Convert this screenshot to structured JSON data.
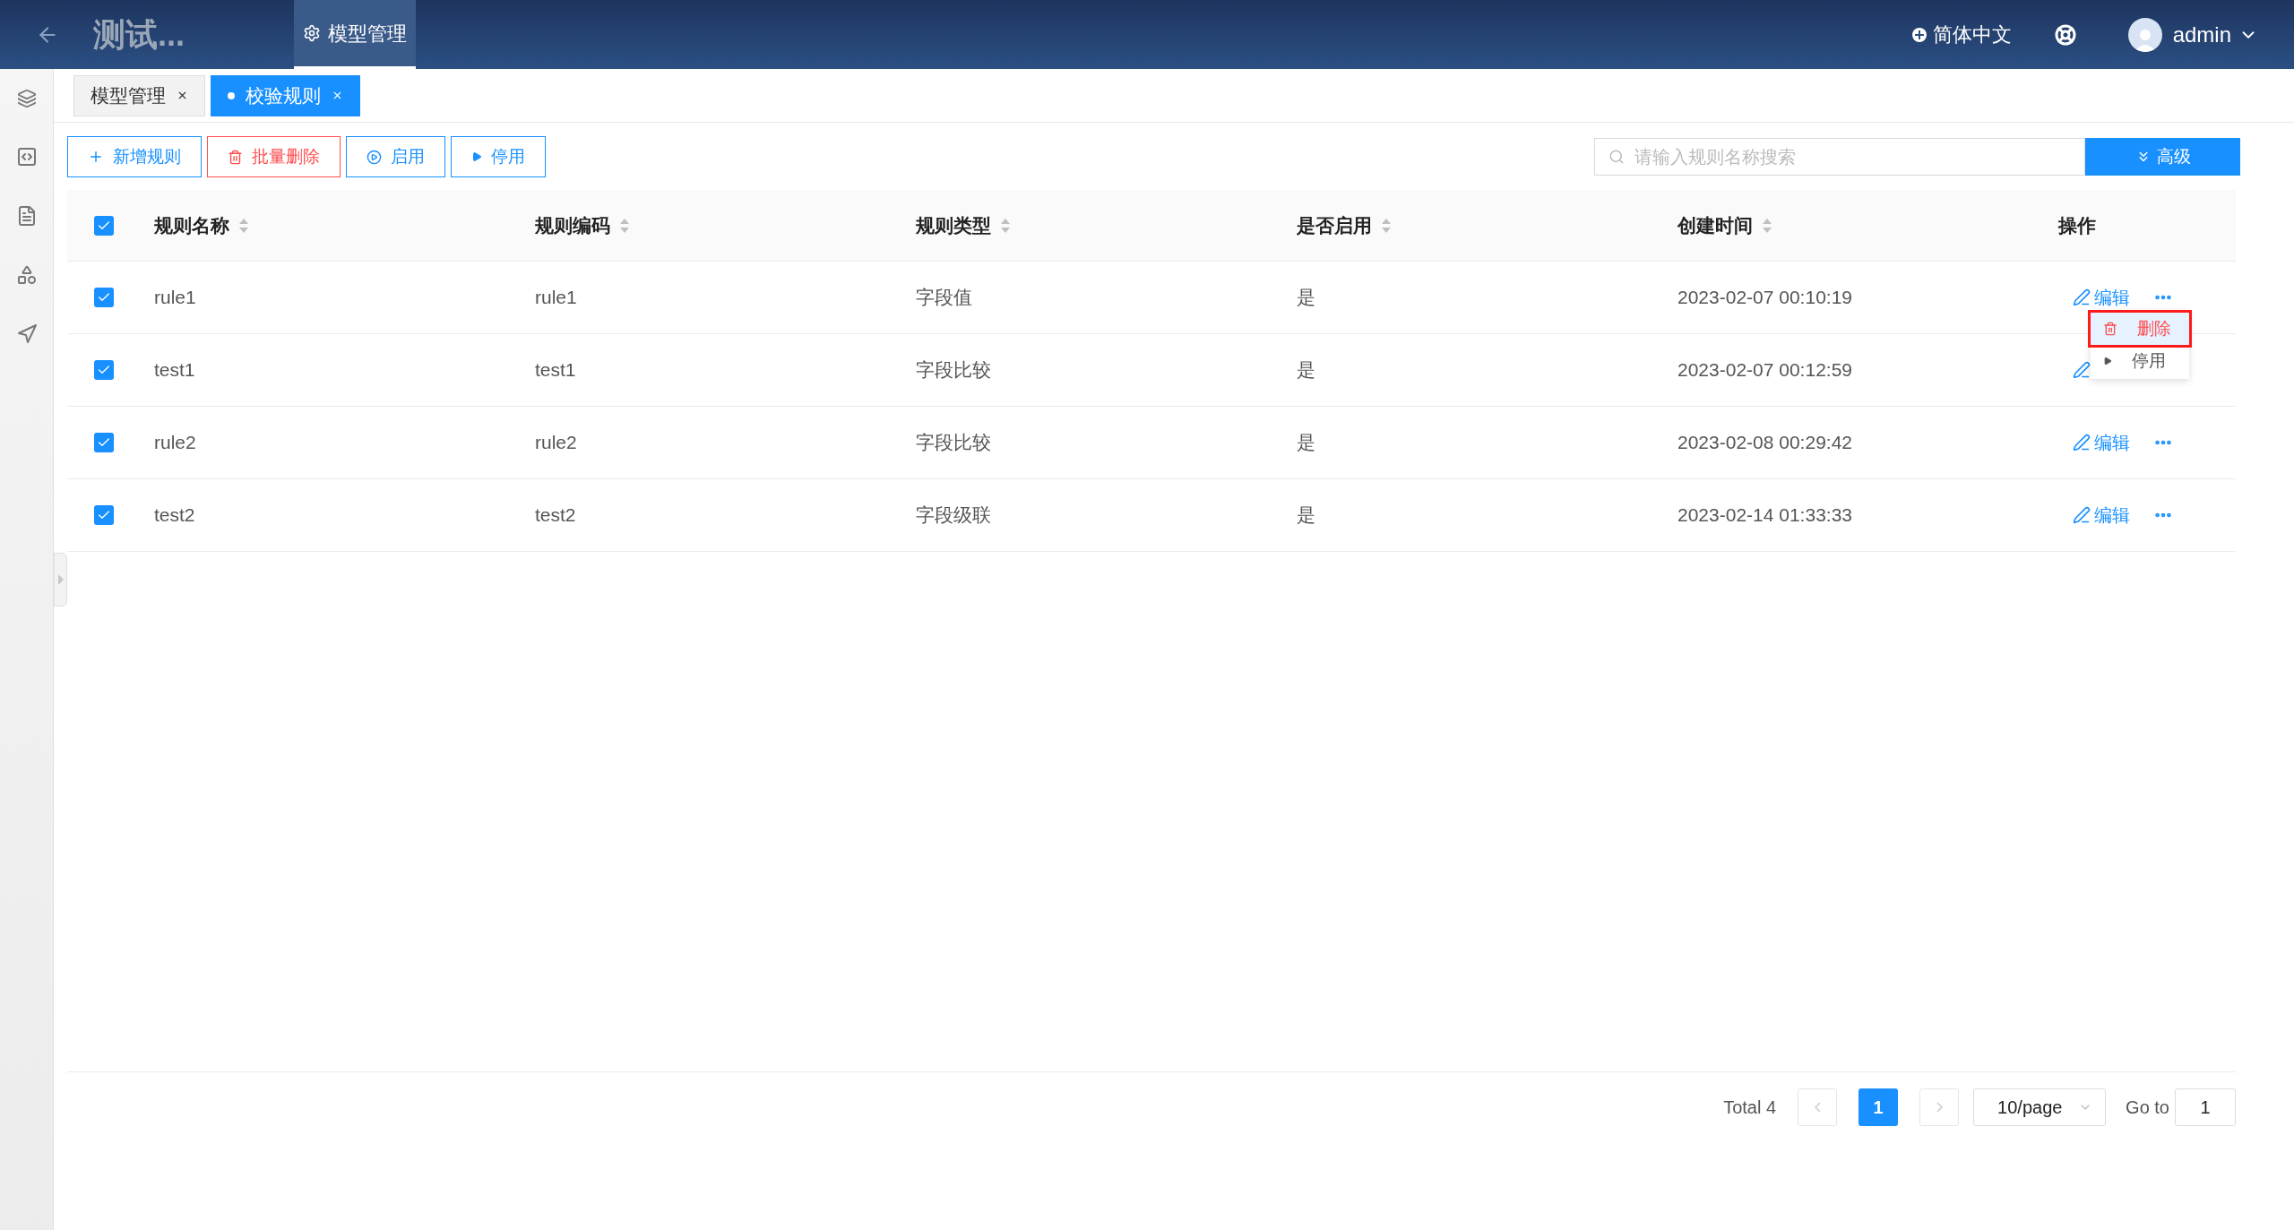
{
  "header": {
    "title": "测试...",
    "nav": [
      {
        "label": "模型管理",
        "selected": true
      }
    ],
    "language": "简体中文",
    "user": "admin"
  },
  "tabs": [
    {
      "label": "模型管理",
      "selected": false
    },
    {
      "label": "校验规则",
      "selected": true
    }
  ],
  "toolbar": {
    "buttons": [
      {
        "label": "新增规则",
        "kind": "add"
      },
      {
        "label": "批量删除",
        "kind": "delete"
      },
      {
        "label": "启用",
        "kind": "enable"
      },
      {
        "label": "停用",
        "kind": "disable"
      }
    ],
    "search": {
      "placeholder": "请输入规则名称搜索"
    },
    "advanced": "高级"
  },
  "table": {
    "all_checked": true,
    "columns": [
      {
        "label": "规则名称",
        "sortable": true
      },
      {
        "label": "规则编码",
        "sortable": true
      },
      {
        "label": "规则类型",
        "sortable": true
      },
      {
        "label": "是否启用",
        "sortable": true
      },
      {
        "label": "创建时间",
        "sortable": true
      },
      {
        "label": "操作",
        "sortable": false
      }
    ],
    "rows": [
      {
        "checked": true,
        "cells": [
          "rule1",
          "rule1",
          "字段值",
          "是",
          "2023-02-07 00:10:19"
        ],
        "edit": "编辑",
        "menu": [
          {
            "label": "删除",
            "kind": "delete",
            "highlighted": true
          },
          {
            "label": "停用",
            "kind": "disable",
            "highlighted": false
          }
        ]
      },
      {
        "checked": true,
        "cells": [
          "test1",
          "test1",
          "字段比较",
          "是",
          "2023-02-07 00:12:59"
        ]
      },
      {
        "checked": true,
        "cells": [
          "rule2",
          "rule2",
          "字段比较",
          "是",
          "2023-02-08 00:29:42"
        ],
        "edit": "编辑"
      },
      {
        "checked": true,
        "cells": [
          "test2",
          "test2",
          "字段级联",
          "是",
          "2023-02-14 01:33:33"
        ],
        "edit": "编辑"
      }
    ]
  },
  "pagination": {
    "total": "Total 4",
    "pages": [
      {
        "label": "1",
        "selected": true
      }
    ],
    "page_size": "10/page",
    "goto_label": "Go to",
    "goto_value": "1"
  }
}
